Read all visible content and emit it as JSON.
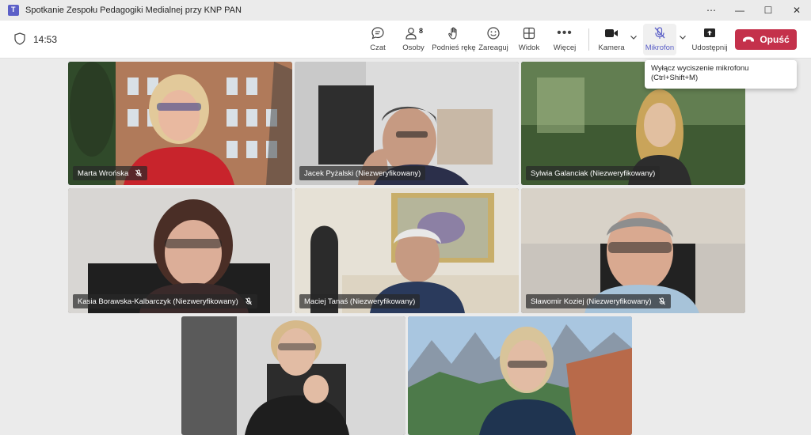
{
  "window": {
    "title": "Spotkanie Zespołu Pedagogiki Medialnej przy KNP PAN"
  },
  "meeting": {
    "elapsed_time": "14:53"
  },
  "toolbar": {
    "chat_label": "Czat",
    "people_label": "Osoby",
    "people_count": "8",
    "raise_hand_label": "Podnieś rękę",
    "react_label": "Zareaguj",
    "view_label": "Widok",
    "more_label": "Więcej",
    "camera_label": "Kamera",
    "mic_label": "Mikrofon",
    "share_label": "Udostępnij",
    "leave_label": "Opuść"
  },
  "tooltip": {
    "line1": "Wyłącz wyciszenie mikrofonu",
    "line2": "(Ctrl+Shift+M)"
  },
  "participants": [
    {
      "name": "Marta Wrońska",
      "muted": true,
      "speaking": false
    },
    {
      "name": "Jacek Pyżalski (Niezweryfikowany)",
      "muted": false,
      "speaking": false
    },
    {
      "name": "Sylwia Galanciak (Niezweryfikowany)",
      "muted": false,
      "speaking": true
    },
    {
      "name": "Kasia Borawska-Kalbarczyk (Niezweryfikowany)",
      "muted": true,
      "speaking": false
    },
    {
      "name": "Maciej Tanaś (Niezweryfikowany)",
      "muted": false,
      "speaking": false
    },
    {
      "name": "Sławomir Koziej (Niezweryfikowany)",
      "muted": true,
      "speaking": false
    },
    {
      "name": "",
      "muted": false,
      "speaking": false
    },
    {
      "name": "",
      "muted": false,
      "speaking": true
    }
  ],
  "colors": {
    "accent": "#6264a7",
    "leave": "#c4314b",
    "mic_active": "#5b5fc7"
  }
}
